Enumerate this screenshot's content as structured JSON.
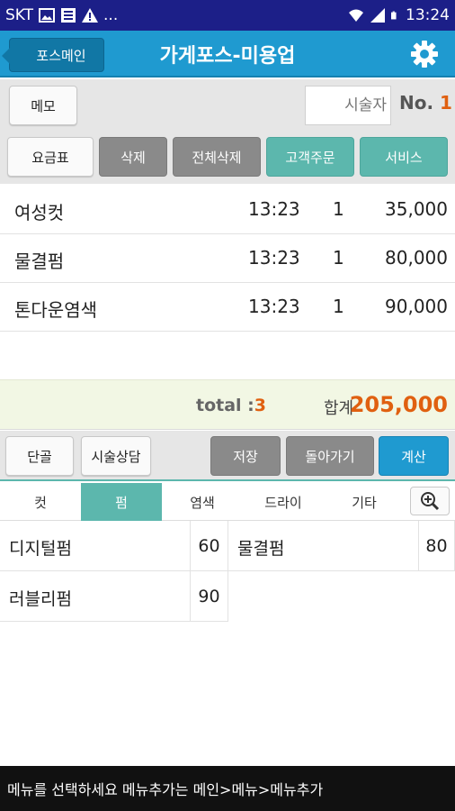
{
  "status_bar": {
    "carrier": "SKT",
    "dots": "...",
    "time": "13:24",
    "icons": [
      "image-icon",
      "notification-icon",
      "warning-icon",
      "wifi-icon",
      "signal-icon",
      "battery-icon"
    ]
  },
  "header": {
    "back_label": "포스메인",
    "title": "가게포스-미용업",
    "settings_icon": "gear-icon",
    "color": "#1f9ad0"
  },
  "controls": {
    "memo_label": "메모",
    "staff_placeholder": "시술자",
    "no_label": "No.",
    "no_value": "1",
    "price_table_label": "요금표",
    "delete_label": "삭제",
    "delete_all_label": "전체삭제",
    "customer_order_label": "고객주문",
    "service_label": "서비스"
  },
  "orders": [
    {
      "name": "여성컷",
      "time": "13:23",
      "qty": "1",
      "price": "35,000"
    },
    {
      "name": "물결펌",
      "time": "13:23",
      "qty": "1",
      "price": "80,000"
    },
    {
      "name": "톤다운염색",
      "time": "13:23",
      "qty": "1",
      "price": "90,000"
    }
  ],
  "totals": {
    "count_label": "total :",
    "count_value": "3",
    "sum_label": "합계",
    "sum_value": "205,000"
  },
  "actions": {
    "regular_label": "단골",
    "consult_label": "시술상담",
    "save_label": "저장",
    "back_label": "돌아가기",
    "checkout_label": "계산"
  },
  "tabs": [
    {
      "label": "컷"
    },
    {
      "label": "펌",
      "active": true
    },
    {
      "label": "염색"
    },
    {
      "label": "드라이"
    },
    {
      "label": "기타"
    }
  ],
  "zoom_icon": "zoom-in-icon",
  "menu_items": [
    {
      "name": "디지털펌",
      "price": "60"
    },
    {
      "name": "물결펌",
      "price": "80"
    },
    {
      "name": "러블리펌",
      "price": "90"
    }
  ],
  "bottom_message": "메뉴를 선택하세요 메뉴추가는 메인>메뉴>메뉴추가",
  "colors": {
    "accent_orange": "#e06010",
    "teal": "#5cb7ad",
    "blue": "#1f9ad0",
    "status_bar": "#1c1f88"
  }
}
